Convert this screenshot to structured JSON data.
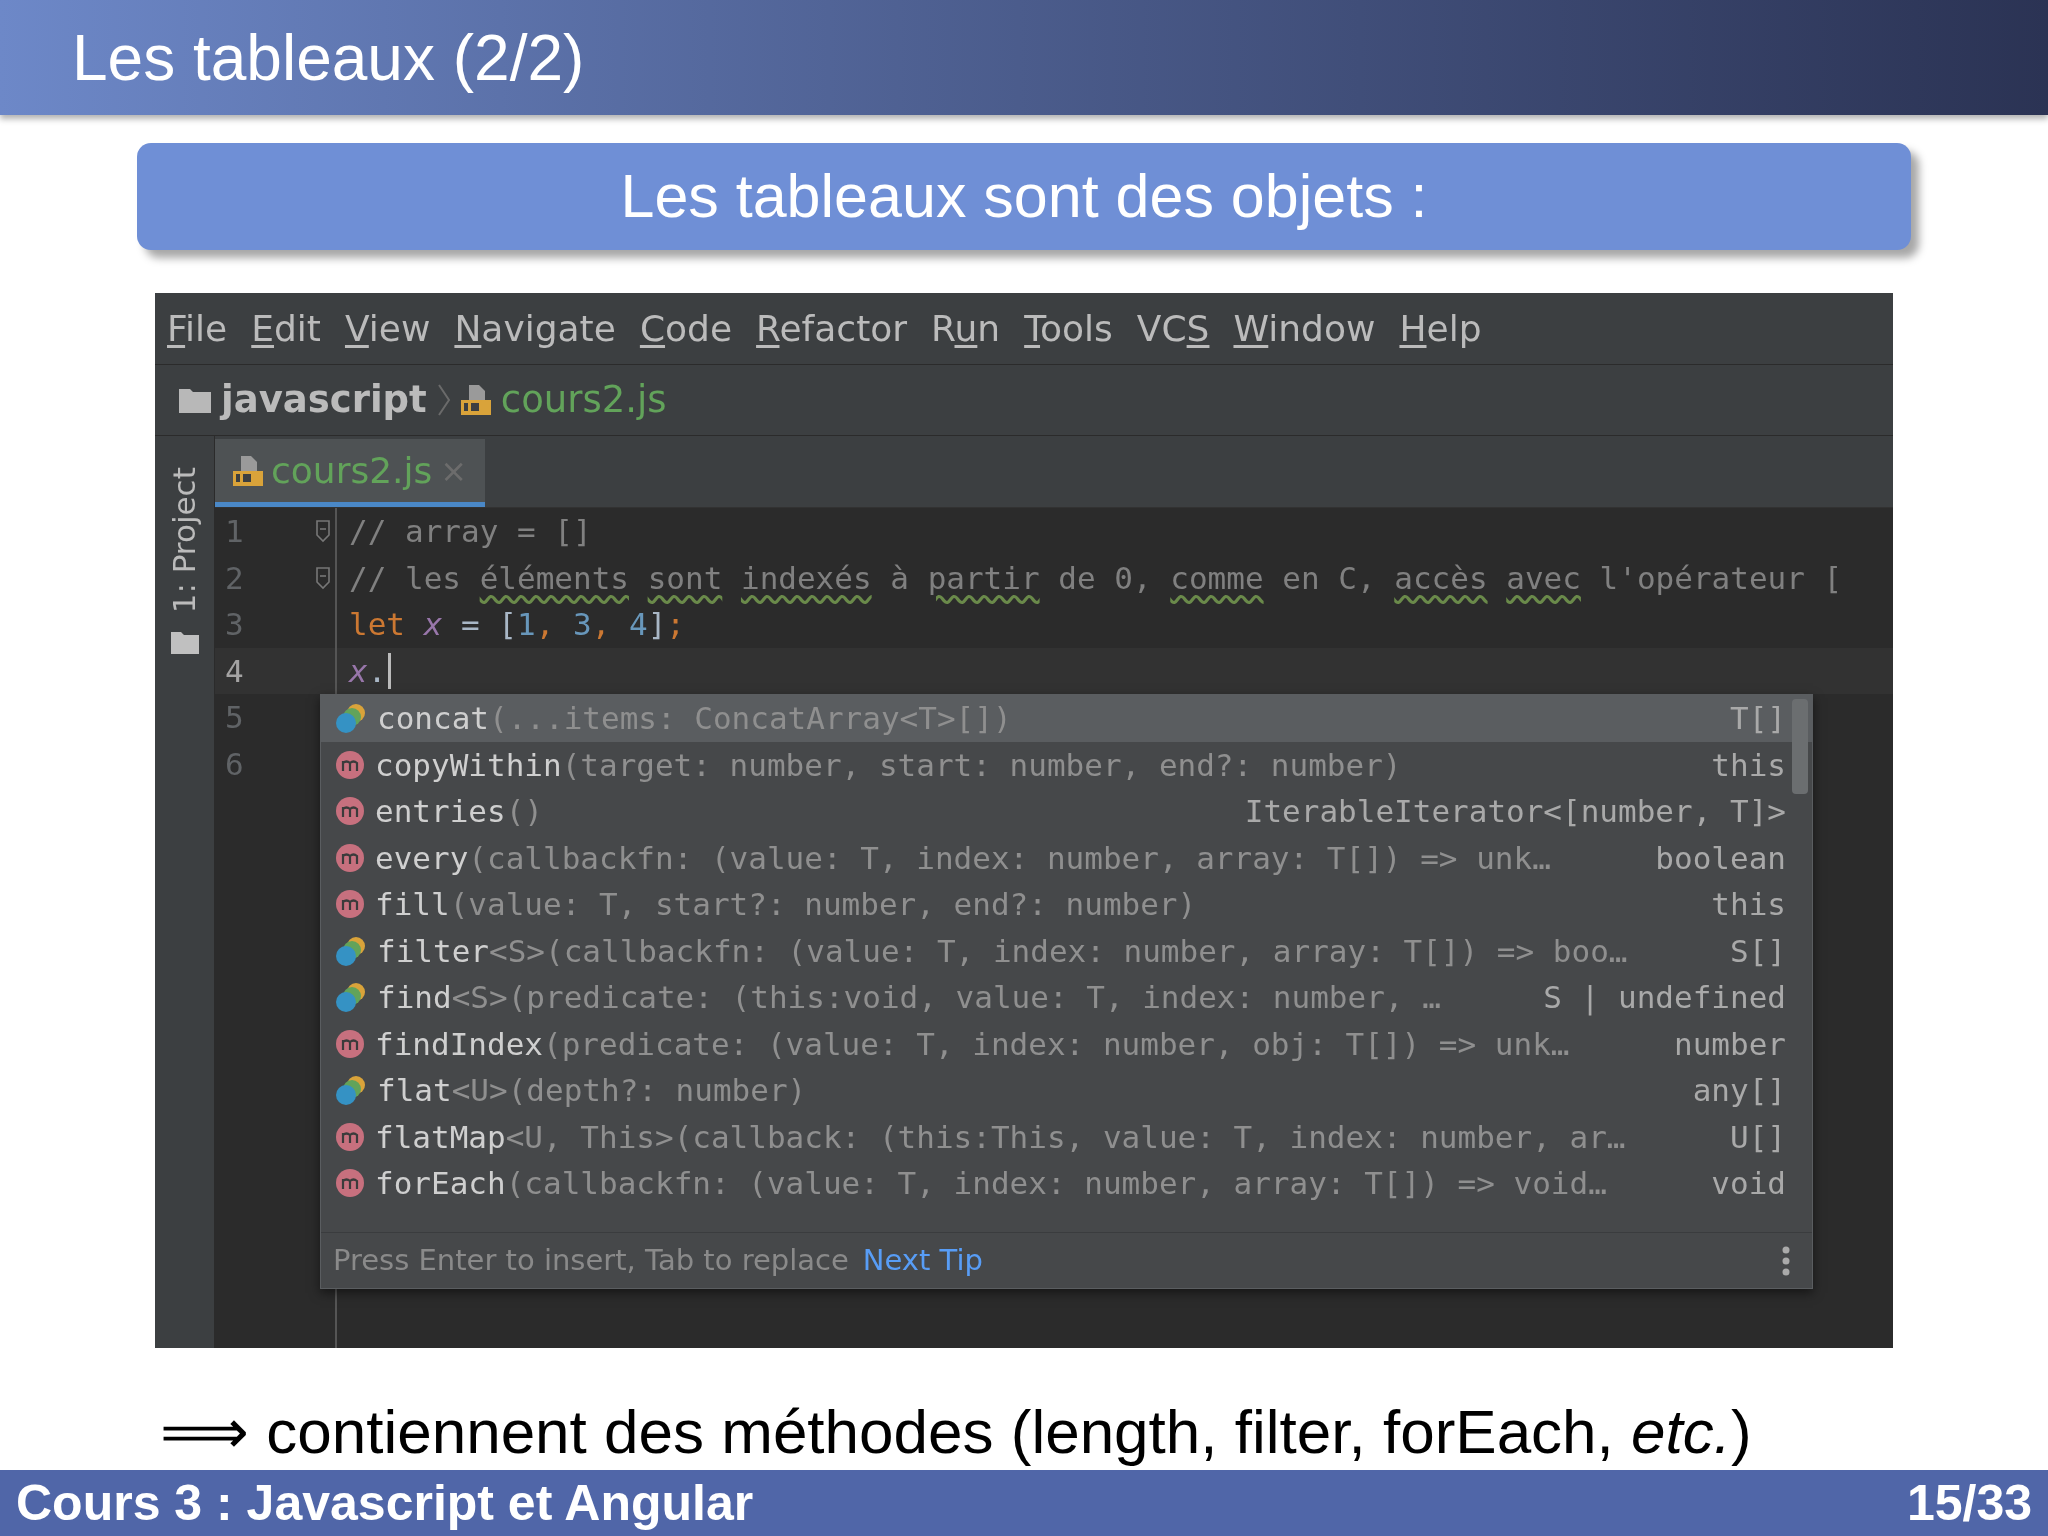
{
  "slide": {
    "title": "Les tableaux (2/2)",
    "block_title": "Les tableaux sont des objets :"
  },
  "ide": {
    "menu": [
      {
        "key": "F",
        "post": "ile"
      },
      {
        "key": "E",
        "post": "dit"
      },
      {
        "key": "V",
        "post": "iew"
      },
      {
        "key": "N",
        "post": "avigate"
      },
      {
        "key": "C",
        "post": "ode"
      },
      {
        "key": "R",
        "post": "efactor"
      },
      {
        "pre": "R",
        "key": "u",
        "post": "n"
      },
      {
        "key": "T",
        "post": "ools"
      },
      {
        "pre": "VC",
        "key": "S"
      },
      {
        "key": "W",
        "post": "indow"
      },
      {
        "key": "H",
        "post": "elp"
      }
    ],
    "breadcrumb": [
      {
        "kind": "folder",
        "label": "javascript"
      },
      {
        "kind": "file",
        "label": "cours2.js"
      }
    ],
    "side_panel": "1: Project",
    "tabs": [
      {
        "label": "cours2.js",
        "close": "×",
        "selected": true
      }
    ],
    "lines": [
      {
        "number": "1",
        "fold": true,
        "current": false,
        "tokens": [
          {
            "kind": "comment",
            "text": "// array = []"
          }
        ]
      },
      {
        "number": "2",
        "fold": true,
        "current": false,
        "tokens": [
          {
            "kind": "comment",
            "text": "// les "
          },
          {
            "kind": "typo",
            "text": "éléments "
          },
          {
            "kind": "typo",
            "text": "sont "
          },
          {
            "kind": "typo",
            "text": "indexés"
          },
          {
            "kind": "comment",
            "text": " à "
          },
          {
            "kind": "typo",
            "text": "partir"
          },
          {
            "kind": "comment",
            "text": " de 0, "
          },
          {
            "kind": "typo",
            "text": "comme"
          },
          {
            "kind": "comment",
            "text": " en C, "
          },
          {
            "kind": "typo",
            "text": "accès "
          },
          {
            "kind": "typo",
            "text": "avec"
          },
          {
            "kind": "comment",
            "text": " l'opérateur ["
          }
        ]
      },
      {
        "number": "3",
        "fold": false,
        "current": false,
        "tokens": [
          {
            "kind": "keyword",
            "text": "let "
          },
          {
            "kind": "variable",
            "text": "x"
          },
          {
            "kind": "plain",
            "text": " = ["
          },
          {
            "kind": "number",
            "text": "1"
          },
          {
            "kind": "keyword",
            "text": ", "
          },
          {
            "kind": "number",
            "text": "3"
          },
          {
            "kind": "keyword",
            "text": ", "
          },
          {
            "kind": "number",
            "text": "4"
          },
          {
            "kind": "plain",
            "text": "]"
          },
          {
            "kind": "keyword",
            "text": ";"
          }
        ]
      },
      {
        "number": "4",
        "fold": false,
        "current": true,
        "cursor": true,
        "tokens": [
          {
            "kind": "variable",
            "text": "x"
          },
          {
            "kind": "plain",
            "text": "."
          }
        ]
      },
      {
        "number": "5",
        "fold": false,
        "current": false
      },
      {
        "number": "6",
        "fold": false,
        "current": false
      }
    ],
    "completion": {
      "items": [
        {
          "kind": "function",
          "name": "concat",
          "signature": "(...items: ConcatArray<T>[])",
          "type": "T[]",
          "selected": true
        },
        {
          "kind": "method",
          "name": "copyWithin",
          "signature": "(target: number, start: number, end?: number)",
          "type": "this",
          "selected": false
        },
        {
          "kind": "method",
          "name": "entries",
          "signature": "()",
          "type": "IterableIterator<[number, T]>",
          "selected": false
        },
        {
          "kind": "method",
          "name": "every",
          "signature": "(callbackfn: (value: T, index: number, array: T[]) => unk…",
          "type": "boolean",
          "selected": false
        },
        {
          "kind": "method",
          "name": "fill",
          "signature": "(value: T, start?: number, end?: number)",
          "type": "this",
          "selected": false
        },
        {
          "kind": "function",
          "name": "filter",
          "signature": "<S>(callbackfn: (value: T, index: number, array: T[]) => boo…",
          "type": "S[]",
          "selected": false
        },
        {
          "kind": "function",
          "name": "find",
          "signature": "<S>(predicate: (this:void, value: T, index: number, …",
          "type": "S | undefined",
          "selected": false
        },
        {
          "kind": "method",
          "name": "findIndex",
          "signature": "(predicate: (value: T, index: number, obj: T[]) => unk…",
          "type": "number",
          "selected": false
        },
        {
          "kind": "function",
          "name": "flat",
          "signature": "<U>(depth?: number)",
          "type": "any[]",
          "selected": false
        },
        {
          "kind": "method",
          "name": "flatMap",
          "signature": "<U, This>(callback: (this:This, value: T, index: number, ar…",
          "type": "U[]",
          "selected": false
        },
        {
          "kind": "method",
          "name": "forEach",
          "signature": "(callbackfn: (value: T, index: number, array: T[]) => void…",
          "type": "void",
          "selected": false
        }
      ],
      "hint": "Press Enter to insert, Tab to replace",
      "tip_link": "Next Tip"
    }
  },
  "conclusion": "⟹ contiennent des méthodes (length, filter, forEach, *etc.*)",
  "footer": {
    "course": "Cours 3 : Javascript et Angular",
    "page": "15/33"
  }
}
